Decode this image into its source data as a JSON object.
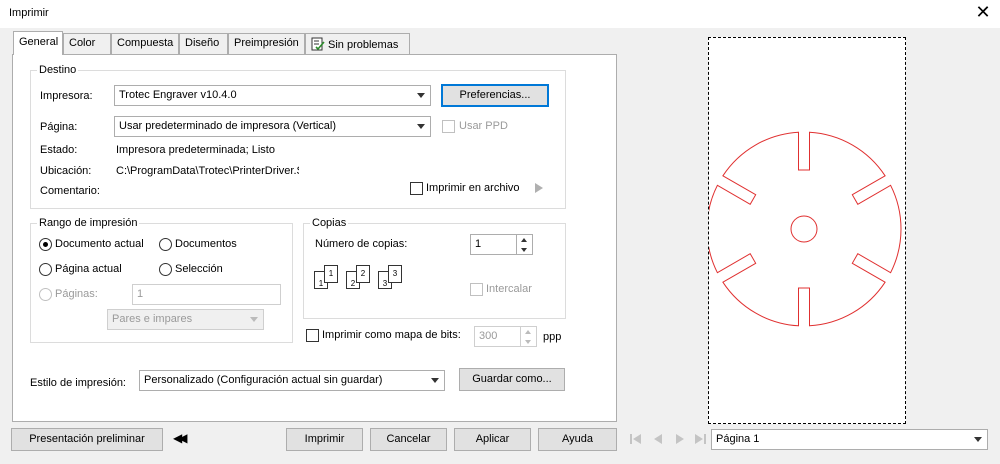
{
  "window": {
    "title": "Imprimir",
    "close_glyph": "✕"
  },
  "tabs": [
    {
      "label": "General"
    },
    {
      "label": "Color"
    },
    {
      "label": "Compuesta"
    },
    {
      "label": "Diseño"
    },
    {
      "label": "Preimpresión"
    },
    {
      "label": "Sin problemas",
      "icon": "checklist-icon"
    }
  ],
  "destino": {
    "legend": "Destino",
    "impresora_label": "Impresora:",
    "impresora_value": "Trotec Engraver v10.4.0",
    "preferencias_button": "Preferencias...",
    "pagina_label": "Página:",
    "pagina_value": "Usar predeterminado de impresora (Vertical)",
    "usar_ppd_label": "Usar PPD",
    "estado_label": "Estado:",
    "estado_value": "Impresora predeterminada; Listo",
    "ubicacion_label": "Ubicación:",
    "ubicacion_value": "C:\\ProgramData\\Trotec\\PrinterDriver.S",
    "comentario_label": "Comentario:",
    "imprimir_archivo_label": "Imprimir en archivo"
  },
  "rango": {
    "legend": "Rango de impresión",
    "documento_actual": "Documento actual",
    "documentos": "Documentos",
    "pagina_actual": "Página actual",
    "seleccion": "Selección",
    "paginas_label": "Páginas:",
    "paginas_value": "1",
    "pares_impares": "Pares e impares"
  },
  "copias": {
    "legend": "Copias",
    "numero_label": "Número de copias:",
    "numero_value": "1",
    "intercalar_label": "Intercalar",
    "collate_numbers": [
      "1",
      "1",
      "2",
      "2",
      "3",
      "3"
    ]
  },
  "bitmap": {
    "label": "Imprimir como mapa de bits:",
    "value": "300",
    "unit": "ppp"
  },
  "estilo": {
    "label": "Estilo de impresión:",
    "value": "Personalizado (Configuración actual sin guardar)",
    "guardar_button": "Guardar como..."
  },
  "footer": {
    "presentacion_button": "Presentación preliminar",
    "collapse_glyph": "◀◀",
    "imprimir_button": "Imprimir",
    "cancelar_button": "Cancelar",
    "aplicar_button": "Aplicar",
    "ayuda_button": "Ayuda"
  },
  "preview": {
    "page_select_value": "Página 1",
    "shape_color": "#e03030"
  },
  "colors": {
    "dialog_bg": "#f0f0f0",
    "focus_border": "#0078d7"
  }
}
